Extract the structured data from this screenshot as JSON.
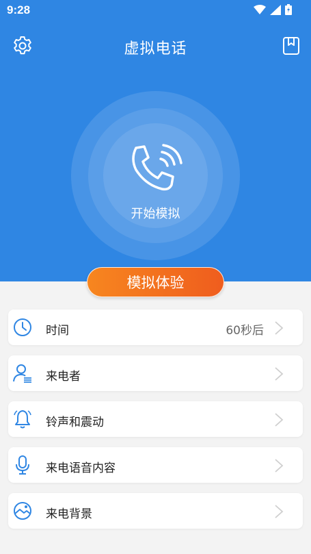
{
  "status": {
    "time": "9:28"
  },
  "appbar": {
    "title": "虚拟电话"
  },
  "call": {
    "start_label": "开始模拟"
  },
  "experience_button": "模拟体验",
  "items": [
    {
      "label": "时间",
      "value": "60秒后",
      "icon": "clock-icon"
    },
    {
      "label": "来电者",
      "value": "",
      "icon": "caller-icon"
    },
    {
      "label": "铃声和震动",
      "value": "",
      "icon": "bell-icon"
    },
    {
      "label": "来电语音内容",
      "value": "",
      "icon": "microphone-icon"
    },
    {
      "label": "来电背景",
      "value": "",
      "icon": "background-icon"
    }
  ],
  "colors": {
    "primary": "#2f86e3",
    "accent": "#ef5d1e"
  }
}
